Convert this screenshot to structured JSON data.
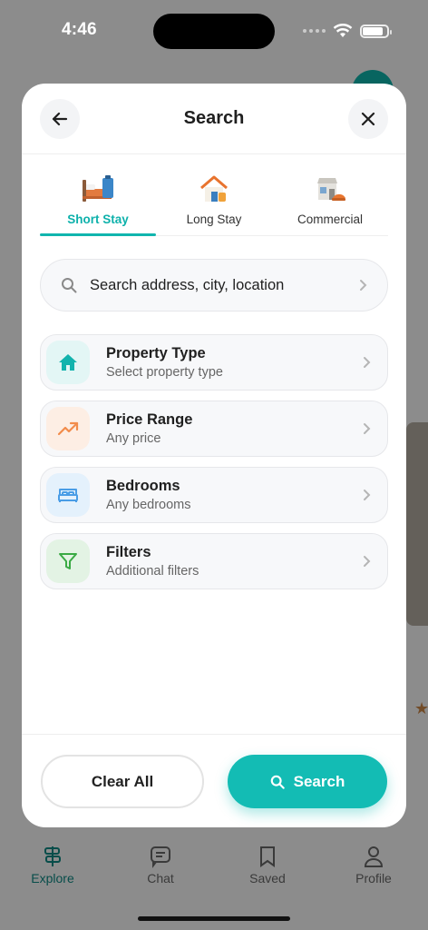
{
  "status_bar": {
    "time": "4:46",
    "battery_level": 0.85
  },
  "modal": {
    "title": "Search",
    "tabs": [
      {
        "label": "Short Stay",
        "icon": "bed-icon",
        "active": true
      },
      {
        "label": "Long Stay",
        "icon": "house-icon",
        "active": false
      },
      {
        "label": "Commercial",
        "icon": "shop-icon",
        "active": false
      }
    ],
    "search": {
      "placeholder": "Search address, city, location"
    },
    "options": [
      {
        "title": "Property Type",
        "subtitle": "Select property type",
        "icon": "home-icon",
        "color": "#12b3ad",
        "bg": "#e3f6f5"
      },
      {
        "title": "Price Range",
        "subtitle": "Any price",
        "icon": "trending-up-icon",
        "color": "#f28c4b",
        "bg": "#fdeee4"
      },
      {
        "title": "Bedrooms",
        "subtitle": "Any bedrooms",
        "icon": "bed-outline-icon",
        "color": "#4a9de6",
        "bg": "#e4f1fc"
      },
      {
        "title": "Filters",
        "subtitle": "Additional filters",
        "icon": "funnel-icon",
        "color": "#3aaa44",
        "bg": "#e3f3e4"
      }
    ],
    "buttons": {
      "clear": "Clear All",
      "search": "Search"
    }
  },
  "bottom_nav": [
    {
      "label": "Explore",
      "active": true
    },
    {
      "label": "Chat",
      "active": false
    },
    {
      "label": "Saved",
      "active": false
    },
    {
      "label": "Profile",
      "active": false
    }
  ],
  "colors": {
    "accent": "#13bcb4",
    "accent_text": "#0db1ab"
  }
}
